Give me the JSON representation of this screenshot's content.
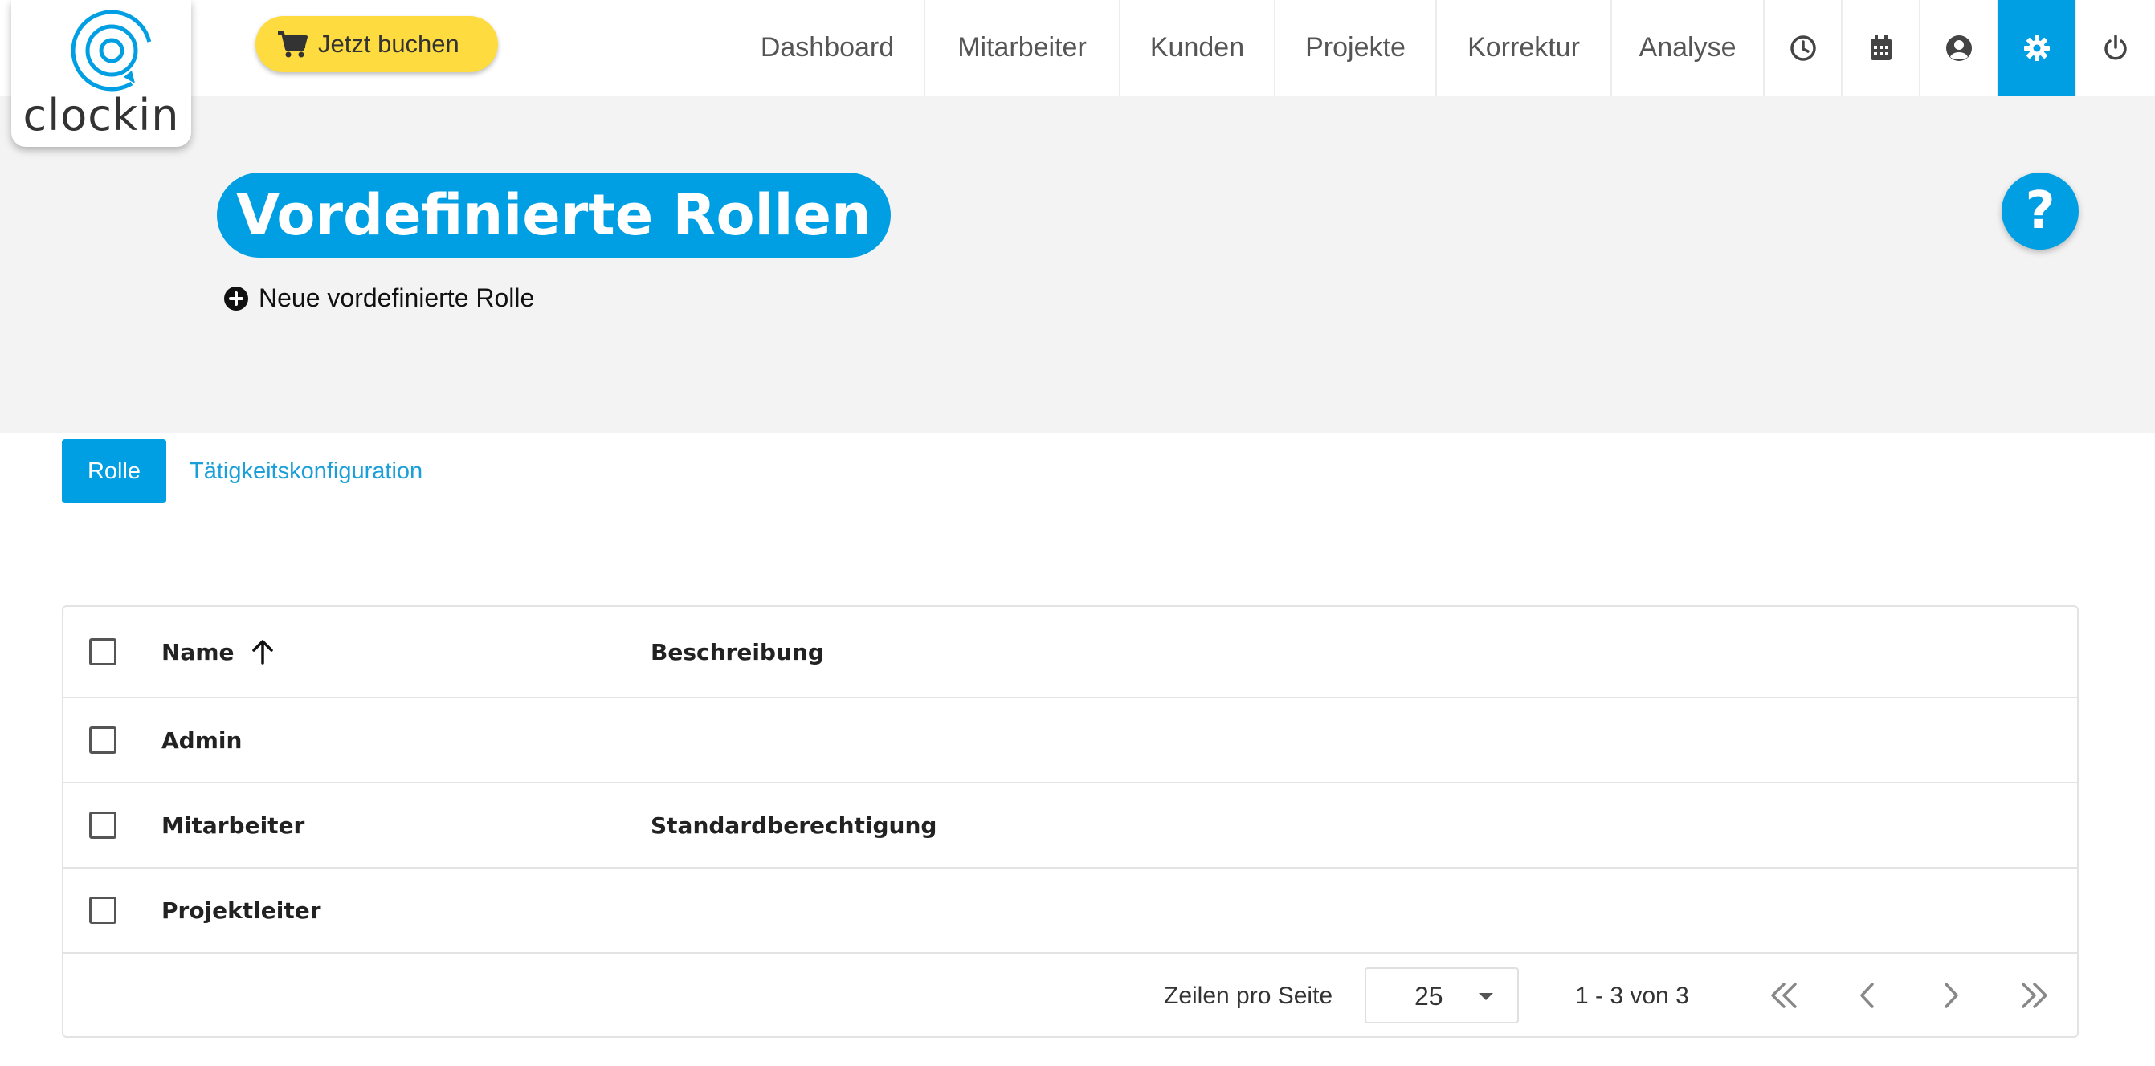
{
  "brand": {
    "name": "clockin",
    "accent": "#009fe3",
    "cta_color": "#fedc3f"
  },
  "topbar": {
    "book_label": "Jetzt buchen",
    "nav": [
      {
        "label": "Dashboard"
      },
      {
        "label": "Mitarbeiter"
      },
      {
        "label": "Kunden"
      },
      {
        "label": "Projekte"
      },
      {
        "label": "Korrektur"
      },
      {
        "label": "Analyse"
      }
    ],
    "icons": [
      "clock-icon",
      "calendar-icon",
      "user-circle-icon",
      "gear-icon",
      "power-icon"
    ],
    "active_icon": "gear-icon"
  },
  "header": {
    "title": "Vordefinierte Rollen",
    "new_label": "Neue vordefinierte Rolle",
    "help_label": "?"
  },
  "tabs": [
    {
      "label": "Rolle",
      "active": true
    },
    {
      "label": "Tätigkeitskonfiguration",
      "active": false
    }
  ],
  "table": {
    "columns": {
      "name": "Name",
      "description": "Beschreibung"
    },
    "sort": {
      "column": "name",
      "direction": "ascending"
    },
    "rows": [
      {
        "name": "Admin",
        "description": ""
      },
      {
        "name": "Mitarbeiter",
        "description": "Standardberechtigung"
      },
      {
        "name": "Projektleiter",
        "description": ""
      }
    ]
  },
  "pagination": {
    "rows_per_page_label": "Zeilen pro Seite",
    "rows_per_page": "25",
    "range": "1 - 3 von 3"
  }
}
